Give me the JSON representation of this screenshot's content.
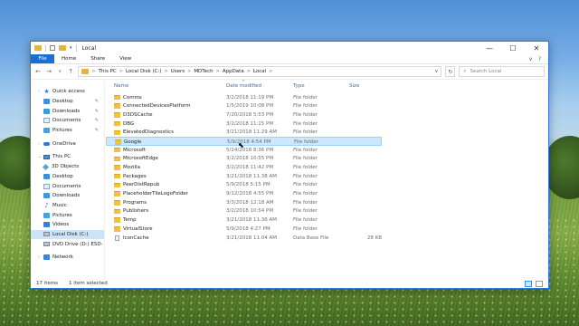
{
  "window": {
    "title": "Local",
    "controls": {
      "minimize": "—",
      "maximize": "☐",
      "close": "✕"
    }
  },
  "ribbon": {
    "tabs": [
      "File",
      "Home",
      "Share",
      "View"
    ],
    "collapse_icon": "∨",
    "help_icon": "?"
  },
  "address": {
    "back": "←",
    "forward": "→",
    "recent": "∨",
    "up": "↑",
    "crumbs": [
      "This PC",
      "Local Disk (C:)",
      "Users",
      "MDTech",
      "AppData",
      "Local"
    ],
    "crumb_sep": ">",
    "dropdown": "∨",
    "refresh": "↻",
    "search_placeholder": "Search Local"
  },
  "navpane": {
    "items": [
      {
        "label": "Quick access",
        "icon": "star-icon",
        "level": 0
      },
      {
        "label": "Desktop",
        "icon": "desktop-icon",
        "level": 1,
        "pinned": true
      },
      {
        "label": "Downloads",
        "icon": "downloads-icon",
        "level": 1,
        "pinned": true
      },
      {
        "label": "Documents",
        "icon": "documents-icon",
        "level": 1,
        "pinned": true
      },
      {
        "label": "Pictures",
        "icon": "pictures-icon",
        "level": 1,
        "pinned": true
      },
      {
        "label": "OneDrive",
        "icon": "onedrive-icon",
        "level": 0
      },
      {
        "label": "This PC",
        "icon": "computer-icon",
        "level": 0
      },
      {
        "label": "3D Objects",
        "icon": "3d-objects-icon",
        "level": 1
      },
      {
        "label": "Desktop",
        "icon": "desktop-icon",
        "level": 1
      },
      {
        "label": "Documents",
        "icon": "documents-icon",
        "level": 1
      },
      {
        "label": "Downloads",
        "icon": "downloads-icon",
        "level": 1
      },
      {
        "label": "Music",
        "icon": "music-icon",
        "level": 1
      },
      {
        "label": "Pictures",
        "icon": "pictures-icon",
        "level": 1
      },
      {
        "label": "Videos",
        "icon": "videos-icon",
        "level": 1
      },
      {
        "label": "Local Disk (C:)",
        "icon": "disk-icon",
        "level": 1,
        "selected": true
      },
      {
        "label": "DVD Drive (D:) ESD-",
        "icon": "dvd-icon",
        "level": 1
      },
      {
        "label": "Network",
        "icon": "network-icon",
        "level": 0
      }
    ]
  },
  "columns": {
    "name": "Name",
    "date": "Date modified",
    "type": "Type",
    "size": "Size",
    "sort_indicator": "^"
  },
  "files": [
    {
      "name": "Comms",
      "date": "3/2/2018 11:19 PM",
      "type": "File folder",
      "size": ""
    },
    {
      "name": "ConnectedDevicesPlatform",
      "date": "1/5/2019 10:08 PM",
      "type": "File folder",
      "size": ""
    },
    {
      "name": "D3DSCache",
      "date": "7/20/2018 5:53 PM",
      "type": "File folder",
      "size": ""
    },
    {
      "name": "DBG",
      "date": "3/2/2018 11:15 PM",
      "type": "File folder",
      "size": ""
    },
    {
      "name": "ElevatedDiagnostics",
      "date": "3/21/2018 11:29 AM",
      "type": "File folder",
      "size": ""
    },
    {
      "name": "Google",
      "date": "5/9/2018 4:54 PM",
      "type": "File folder",
      "size": "",
      "selected": true
    },
    {
      "name": "Microsoft",
      "date": "5/24/2018 8:36 PM",
      "type": "File folder",
      "size": ""
    },
    {
      "name": "MicrosoftEdge",
      "date": "3/2/2018 10:55 PM",
      "type": "File folder",
      "size": ""
    },
    {
      "name": "Mozilla",
      "date": "3/2/2018 11:42 PM",
      "type": "File folder",
      "size": ""
    },
    {
      "name": "Packages",
      "date": "3/21/2018 11:38 AM",
      "type": "File folder",
      "size": ""
    },
    {
      "name": "PeerDistRepub",
      "date": "5/9/2018 5:15 PM",
      "type": "File folder",
      "size": ""
    },
    {
      "name": "PlaceholderTileLogoFolder",
      "date": "9/12/2018 4:55 PM",
      "type": "File folder",
      "size": ""
    },
    {
      "name": "Programs",
      "date": "3/3/2018 12:18 AM",
      "type": "File folder",
      "size": ""
    },
    {
      "name": "Publishers",
      "date": "3/2/2018 10:54 PM",
      "type": "File folder",
      "size": ""
    },
    {
      "name": "Temp",
      "date": "3/21/2018 11:36 AM",
      "type": "File folder",
      "size": ""
    },
    {
      "name": "VirtualStore",
      "date": "5/9/2018 4:27 PM",
      "type": "File folder",
      "size": ""
    },
    {
      "name": "IconCache",
      "date": "3/21/2018 11:04 AM",
      "type": "Data Base File",
      "size": "28 KB",
      "is_file": true
    }
  ],
  "status": {
    "count": "17 items",
    "selection": "1 item selected"
  }
}
